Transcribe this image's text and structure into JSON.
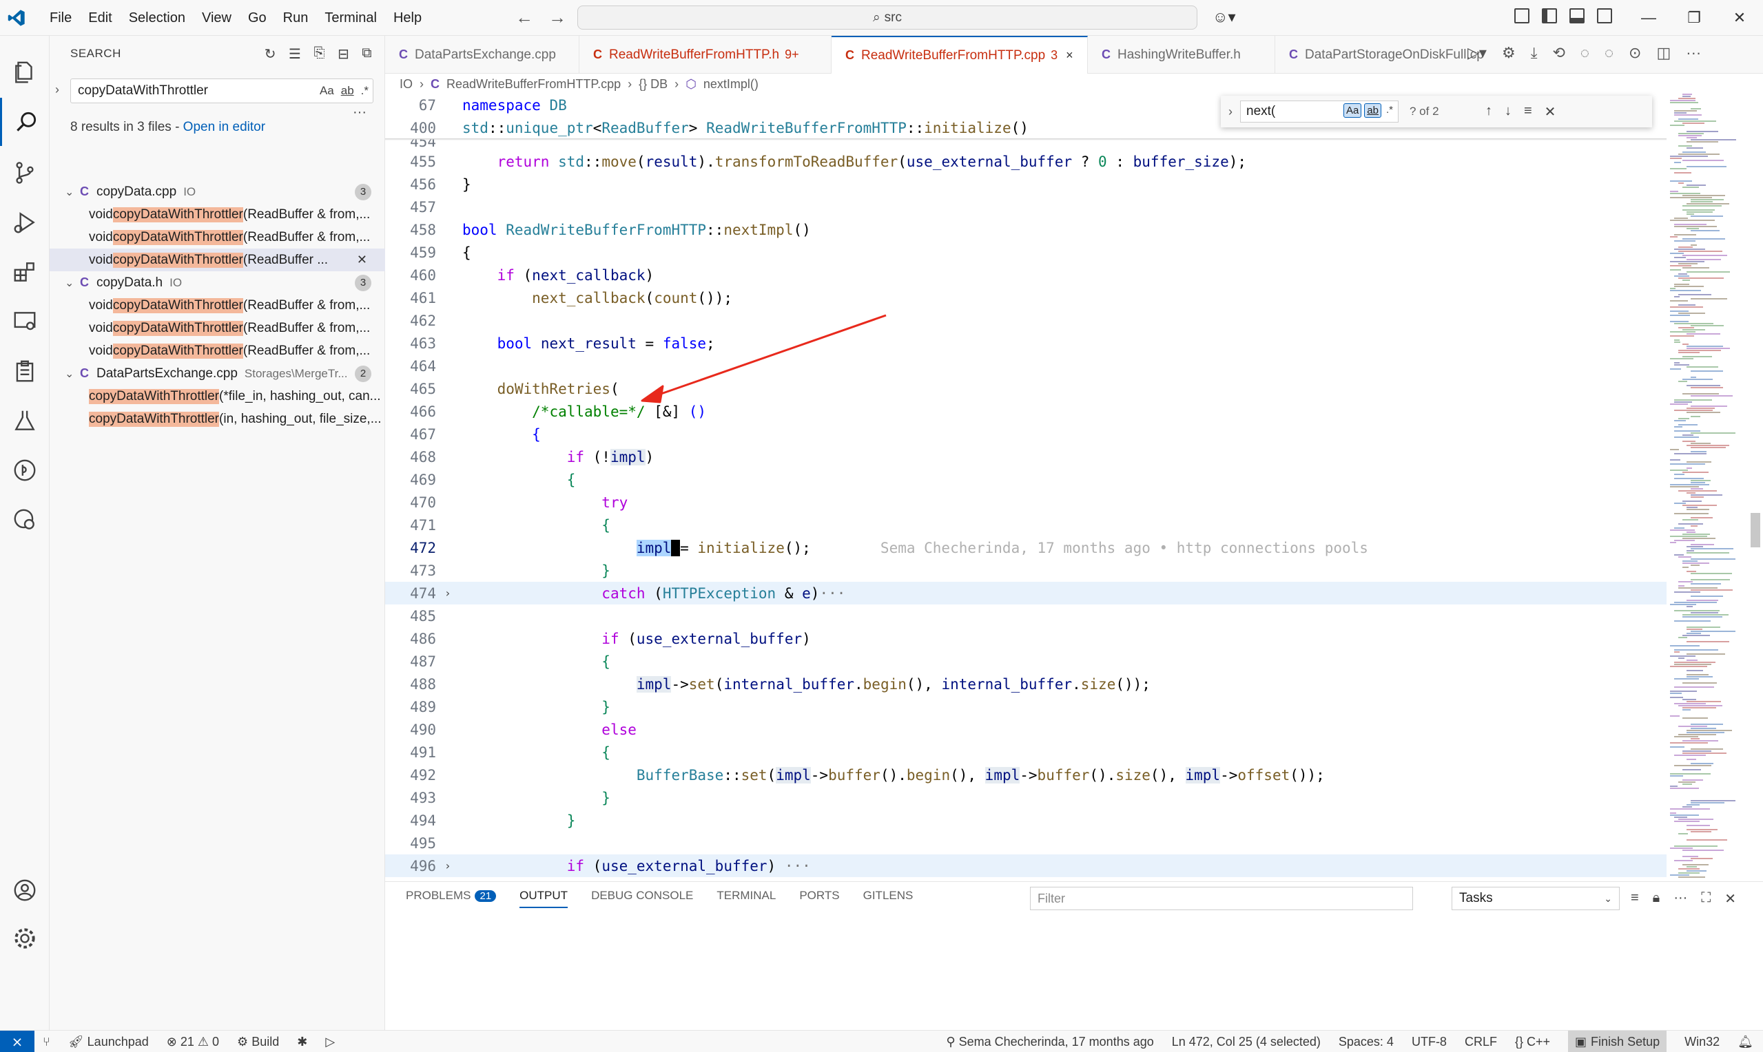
{
  "menu": [
    "File",
    "Edit",
    "Selection",
    "View",
    "Go",
    "Run",
    "Terminal",
    "Help"
  ],
  "command_center": "src",
  "sidebar": {
    "title": "SEARCH",
    "query": "copyDataWithThrottler",
    "opt_case": "Aa",
    "opt_word": "ab",
    "opt_regex": ".*",
    "summary": "8 results in 3 files - ",
    "open_in_editor": "Open in editor",
    "files": [
      {
        "name": "copyData.cpp",
        "path": "IO",
        "count": "3",
        "icon": "C",
        "matches": [
          {
            "pre": "void ",
            "hit": "copyDataWithThrottler",
            "post": "(ReadBuffer & from,..."
          },
          {
            "pre": "void ",
            "hit": "copyDataWithThrottler",
            "post": "(ReadBuffer & from,..."
          },
          {
            "pre": "void ",
            "hit": "copyDataWithThrottler",
            "post": "(ReadBuffer ..."
          }
        ]
      },
      {
        "name": "copyData.h",
        "path": "IO",
        "count": "3",
        "icon": "C",
        "matches": [
          {
            "pre": "void ",
            "hit": "copyDataWithThrottler",
            "post": "(ReadBuffer & from,..."
          },
          {
            "pre": "void ",
            "hit": "copyDataWithThrottler",
            "post": "(ReadBuffer & from,..."
          },
          {
            "pre": "void ",
            "hit": "copyDataWithThrottler",
            "post": "(ReadBuffer & from,..."
          }
        ]
      },
      {
        "name": "DataPartsExchange.cpp",
        "path": "Storages\\MergeTr...",
        "count": "2",
        "icon": "C",
        "matches": [
          {
            "pre": "",
            "hit": "copyDataWithThrottler",
            "post": "(*file_in, hashing_out, can..."
          },
          {
            "pre": "",
            "hit": "copyDataWithThrottler",
            "post": "(in, hashing_out, file_size,..."
          }
        ]
      }
    ]
  },
  "tabs": [
    {
      "label": "DataPartsExchange.cpp",
      "icon": "C",
      "count": "",
      "close": "",
      "active": false,
      "error": false
    },
    {
      "label": "ReadWriteBufferFromHTTP.h",
      "icon": "C",
      "count": "9+",
      "close": "",
      "active": false,
      "error": true
    },
    {
      "label": "ReadWriteBufferFromHTTP.cpp",
      "icon": "C",
      "count": "3",
      "close": "×",
      "active": true,
      "error": true
    },
    {
      "label": "HashingWriteBuffer.h",
      "icon": "C",
      "count": "",
      "close": "",
      "active": false,
      "error": false
    },
    {
      "label": "DataPartStorageOnDiskFull.cp",
      "icon": "C",
      "count": "",
      "close": "",
      "active": false,
      "error": false
    }
  ],
  "breadcrumb": [
    "IO",
    "ReadWriteBufferFromHTTP.cpp",
    "{} DB",
    "nextImpl()"
  ],
  "find": {
    "value": "next(",
    "opt_case": "Aa",
    "opt_word": "ab",
    "opt_regex": ".*",
    "count": "? of 2"
  },
  "blame": "Sema Checherinda, 17 months ago • http connections pools",
  "panel": {
    "tabs": [
      "PROBLEMS",
      "OUTPUT",
      "DEBUG CONSOLE",
      "TERMINAL",
      "PORTS",
      "GITLENS"
    ],
    "problems_count": "21",
    "active_tab": "OUTPUT",
    "filter_placeholder": "Filter",
    "select_value": "Tasks"
  },
  "status": {
    "launchpad": "Launchpad",
    "errors": "21",
    "warnings": "0",
    "build": "Build",
    "blame": "Sema Checherinda, 17 months ago",
    "position": "Ln 472, Col 25 (4 selected)",
    "spaces": "Spaces: 4",
    "encoding": "UTF-8",
    "eol": "CRLF",
    "language": "C++",
    "finish": "Finish Setup",
    "platform": "Win32"
  },
  "colors": {
    "accent": "#005fb8",
    "error": "#c72e0f",
    "match_highlight": "#f4b89b",
    "selection": "#add6ff",
    "arrow": "#e8291c"
  }
}
